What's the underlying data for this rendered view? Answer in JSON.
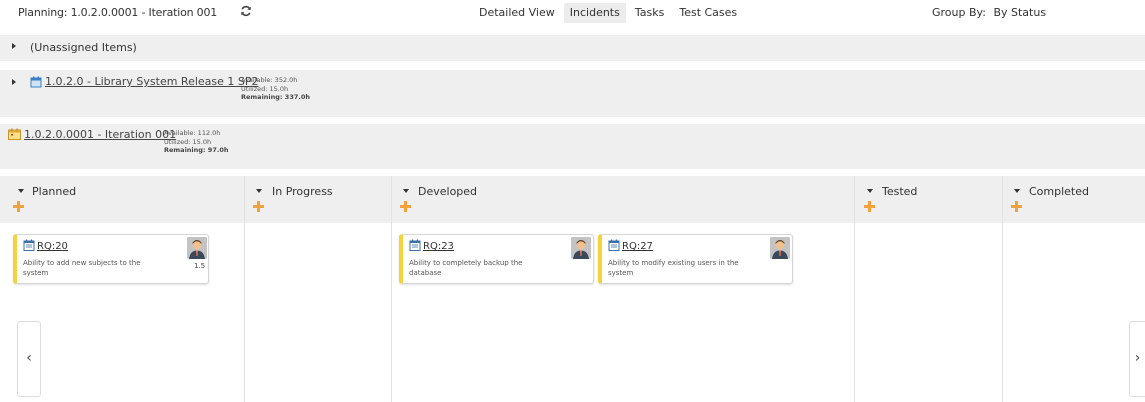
{
  "header": {
    "planning_label": "Planning: 1.0.2.0.0001 - Iteration 001",
    "refresh_icon": "refresh-icon",
    "view_tabs": [
      "Detailed View",
      "Incidents",
      "Tasks",
      "Test Cases"
    ],
    "active_tab": "Incidents",
    "group_by_label": "Group By:",
    "group_by_value": "By Status"
  },
  "rows": {
    "unassigned": {
      "label": "(Unassigned Items)"
    },
    "release": {
      "icon": "release-icon",
      "label": "1.0.2.0 - Library System Release 1 SP2",
      "available": "Available: 352.0h",
      "utilized": "Utilized: 15.0h",
      "remaining": "Remaining: 337.0h"
    },
    "iteration": {
      "icon": "iteration-icon",
      "label": "1.0.2.0.0001 - Iteration 001",
      "available": "Available: 112.0h",
      "utilized": "Utilized: 15.0h",
      "remaining": "Remaining: 97.0h"
    }
  },
  "columns": [
    {
      "title": "Planned"
    },
    {
      "title": "In Progress"
    },
    {
      "title": "Developed"
    },
    {
      "title": "Tested"
    },
    {
      "title": "Completed"
    }
  ],
  "cards": [
    {
      "id": "RQ:20",
      "description": "Ability to add new subjects to the system",
      "estimate": "1.5",
      "column": "Planned"
    },
    {
      "id": "RQ:23",
      "description": "Ability to completely backup the database",
      "estimate": "",
      "column": "Developed"
    },
    {
      "id": "RQ:27",
      "description": "Ability to modify existing users in the system",
      "estimate": "",
      "column": "Developed"
    }
  ],
  "pager": {
    "prev": "‹",
    "next": "›"
  },
  "colors": {
    "accent_add": "#f0a23c",
    "card_stripe": "#f5d33a",
    "row_bg": "#efefef",
    "tab_active_bg": "#ececec"
  }
}
